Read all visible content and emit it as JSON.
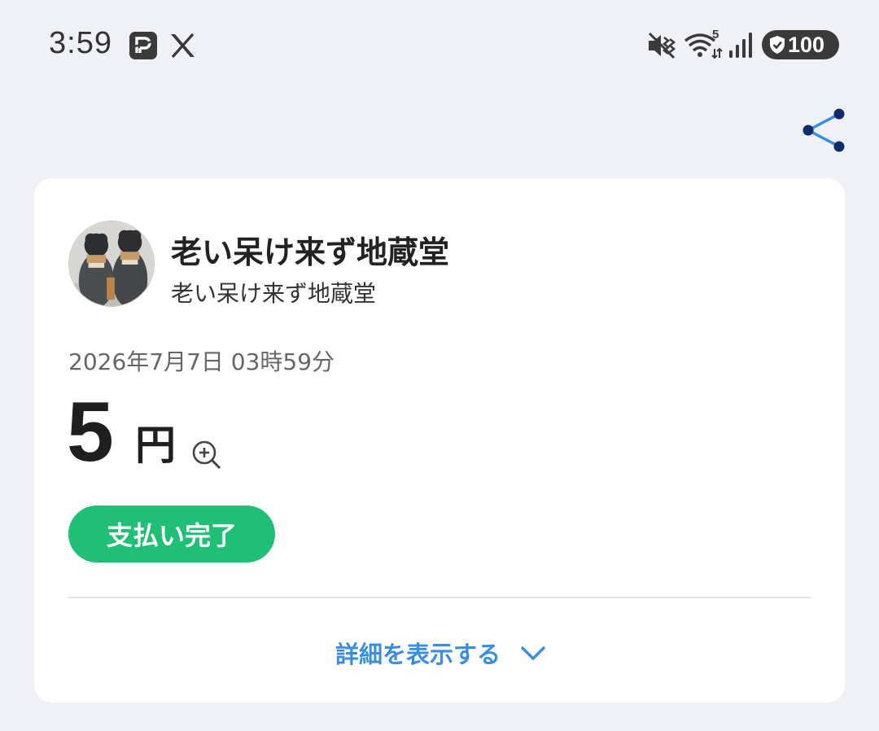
{
  "status_bar": {
    "time": "3:59",
    "app_icons": [
      "paypay-icon",
      "x-icon"
    ],
    "system_icons": [
      "vibrate-mute-icon",
      "wifi-icon",
      "signal-icon"
    ],
    "wifi_badge": "5",
    "battery": "100"
  },
  "merchant": {
    "name": "老い呆け来ず地蔵堂",
    "subname": "老い呆け来ず地蔵堂"
  },
  "transaction": {
    "datetime": "2026年7月7日 03時59分",
    "amount": "5",
    "unit": "円",
    "status": "支払い完了"
  },
  "details": {
    "label": "詳細を表示する"
  },
  "colors": {
    "background": "#eff1f6",
    "card": "#ffffff",
    "status_green": "#1fbf76",
    "link_blue": "#3b8de0",
    "share_blue": "#2f8fe0",
    "share_navy": "#0f2b6e"
  }
}
